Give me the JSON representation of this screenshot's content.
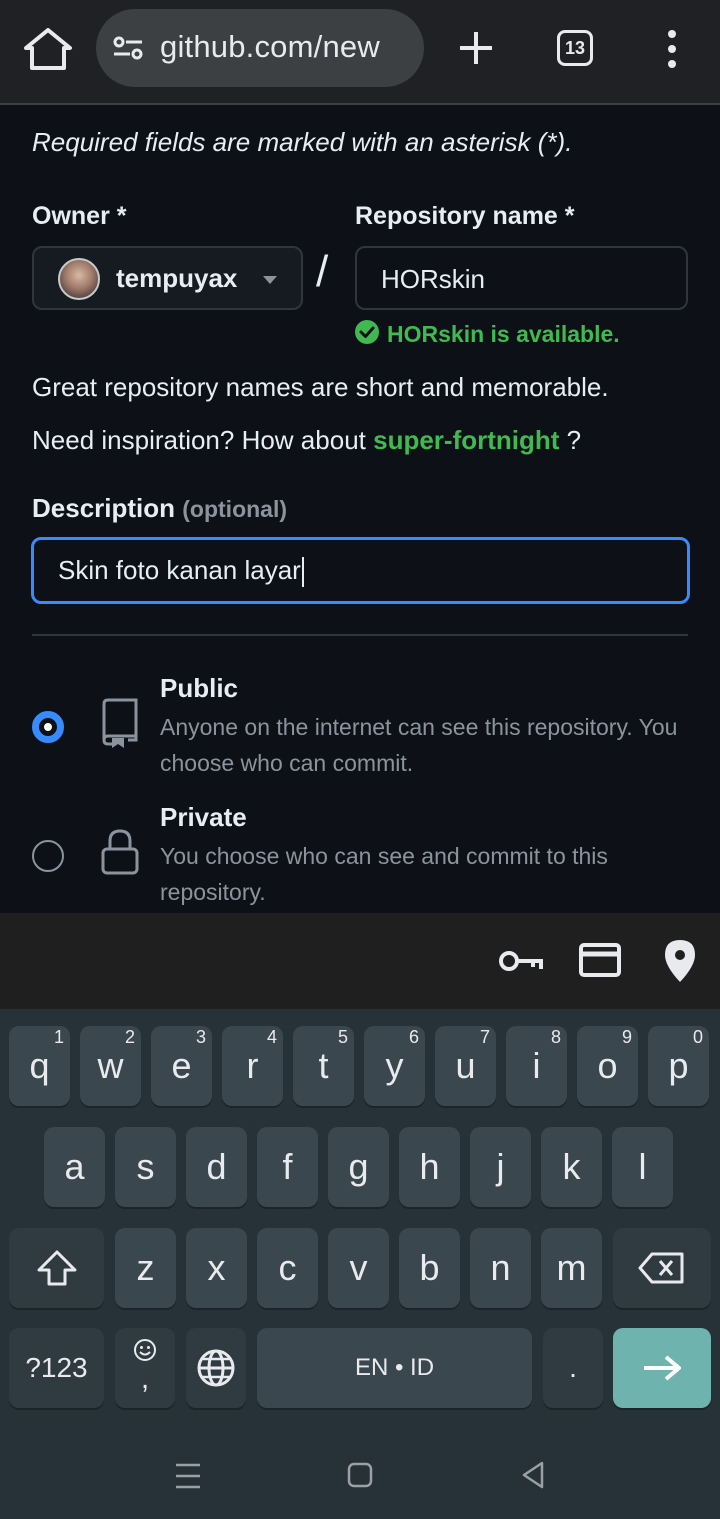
{
  "browser": {
    "url": "github.com/new",
    "tab_count": "13"
  },
  "form": {
    "required_note": "Required fields are marked with an asterisk (*).",
    "owner_label": "Owner *",
    "owner_value": "tempuyax",
    "separator": "/",
    "repo_label": "Repository name *",
    "repo_value": "HORskin",
    "availability": "HORskin is available.",
    "help_text": "Great repository names are short and memorable.",
    "inspiration_prefix": "Need inspiration? How about",
    "inspiration_suggestion": "super-fortnight",
    "inspiration_suffix": "?",
    "description_label": "Description",
    "description_optional": "(optional)",
    "description_value": "Skin foto kanan layar",
    "visibility": [
      {
        "title": "Public",
        "desc": "Anyone on the internet can see this repository. You choose who can commit.",
        "selected": true
      },
      {
        "title": "Private",
        "desc": "You choose who can see and commit to this repository.",
        "selected": false
      }
    ]
  },
  "autofill_bar": {
    "icons": [
      "key-icon",
      "credit-card-icon",
      "location-pin-icon"
    ]
  },
  "keyboard": {
    "row1": [
      {
        "k": "q",
        "n": "1"
      },
      {
        "k": "w",
        "n": "2"
      },
      {
        "k": "e",
        "n": "3"
      },
      {
        "k": "r",
        "n": "4"
      },
      {
        "k": "t",
        "n": "5"
      },
      {
        "k": "y",
        "n": "6"
      },
      {
        "k": "u",
        "n": "7"
      },
      {
        "k": "i",
        "n": "8"
      },
      {
        "k": "o",
        "n": "9"
      },
      {
        "k": "p",
        "n": "0"
      }
    ],
    "row2": [
      "a",
      "s",
      "d",
      "f",
      "g",
      "h",
      "j",
      "k",
      "l"
    ],
    "row3": [
      "z",
      "x",
      "c",
      "v",
      "b",
      "n",
      "m"
    ],
    "symbols_label": "?123",
    "emoji_comma": ",",
    "space_label": "EN • ID",
    "period": "."
  },
  "colors": {
    "accent_blue": "#388bfd",
    "success_green": "#3fb950",
    "background": "#0d1117",
    "enter_key": "#6fb3ae"
  }
}
